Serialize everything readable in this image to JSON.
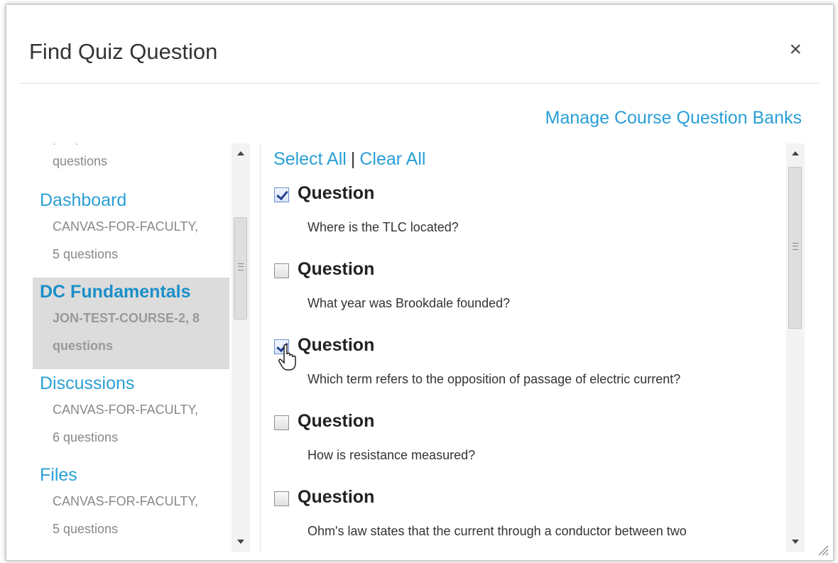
{
  "dialog": {
    "title": "Find Quiz Question",
    "close_glyph": "×",
    "manage_link": "Manage Course Question Banks"
  },
  "sidebar": {
    "top_fragment": "questions",
    "banks": [
      {
        "name": "Dashboard",
        "course": "CANVAS-FOR-FACULTY,",
        "count": "5 questions",
        "selected": false
      },
      {
        "name": "DC Fundamentals",
        "course": "JON-TEST-COURSE-2, 8",
        "count": "questions",
        "selected": true
      },
      {
        "name": "Discussions",
        "course": "CANVAS-FOR-FACULTY,",
        "count": "6 questions",
        "selected": false
      },
      {
        "name": "Files",
        "course": "CANVAS-FOR-FACULTY,",
        "count": "5 questions",
        "selected": false
      }
    ]
  },
  "questions_panel": {
    "select_all": "Select All",
    "separator": "|",
    "clear_all": "Clear All",
    "questions": [
      {
        "title": "Question",
        "text": "Where is the TLC located?",
        "checked": true
      },
      {
        "title": "Question",
        "text": "What year was Brookdale founded?",
        "checked": false
      },
      {
        "title": "Question",
        "text": "Which term refers to the opposition of passage of electric current?",
        "checked": true
      },
      {
        "title": "Question",
        "text": "How is resistance measured?",
        "checked": false
      },
      {
        "title": "Question",
        "text": "Ohm's law states that the current through a conductor between two",
        "checked": false
      }
    ]
  },
  "icons": {
    "close": "close-icon",
    "cursor": "hand-pointer-icon",
    "resize": "resize-grip-icon"
  }
}
